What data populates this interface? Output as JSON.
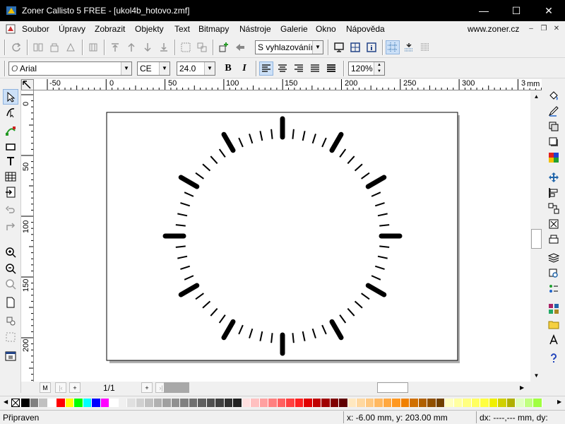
{
  "window": {
    "title": "Zoner Callisto 5 FREE - [ukol4b_hotovo.zmf]",
    "minimize_label": "—",
    "maximize_label": "☐",
    "close_label": "✕"
  },
  "menu": {
    "items": [
      "Soubor",
      "Úpravy",
      "Zobrazit",
      "Objekty",
      "Text",
      "Bitmapy",
      "Nástroje",
      "Galerie",
      "Okno",
      "Nápověda"
    ],
    "url": "www.zoner.cz",
    "mdi_minimize": "–",
    "mdi_restore": "❐",
    "mdi_close": "✕"
  },
  "toolbar1": {
    "smoothing_select": "S vyhlazováním"
  },
  "toolbar2": {
    "font_select": "Arial",
    "charset_select": "CE",
    "font_size": "24.0",
    "bold_label": "B",
    "italic_label": "I",
    "zoom_value": "120%"
  },
  "rulers": {
    "h_labels": [
      "-50",
      "0",
      "50",
      "100",
      "150",
      "200",
      "250",
      "300",
      "3"
    ],
    "h_unit": "mm",
    "v_labels": [
      "0",
      "50",
      "100",
      "150",
      "200"
    ]
  },
  "navigation": {
    "page_indicator": "1/1",
    "first_label": "M",
    "add_label": "+"
  },
  "palette": {
    "colors": [
      "#000000",
      "#808080",
      "#c0c0c0",
      "#ffffff",
      "#ff0000",
      "#ffff00",
      "#00ff00",
      "#00ffff",
      "#0000ff",
      "#ff00ff",
      "#ffffff",
      "#f0f0f0",
      "#e0e0e0",
      "#d0d0d0",
      "#c0c0c0",
      "#b0b0b0",
      "#a0a0a0",
      "#909090",
      "#808080",
      "#707070",
      "#606060",
      "#505050",
      "#404040",
      "#303030",
      "#202020",
      "#ffe0e0",
      "#ffc0c0",
      "#ffa0a0",
      "#ff8080",
      "#ff6060",
      "#ff4040",
      "#ff2020",
      "#e00000",
      "#c00000",
      "#a00000",
      "#800000",
      "#600000",
      "#ffe8c0",
      "#ffd8a0",
      "#ffc880",
      "#ffb860",
      "#ffa840",
      "#ff9820",
      "#f08000",
      "#d07000",
      "#b06000",
      "#905000",
      "#704000",
      "#ffffc0",
      "#ffffa0",
      "#ffff80",
      "#ffff60",
      "#ffff40",
      "#f0f000",
      "#d0d000",
      "#b0b000",
      "#e0ffc0",
      "#c0ff80",
      "#a0ff40"
    ]
  },
  "status": {
    "ready": "Připraven",
    "coords": "x: -6.00 mm, y: 203.00 mm",
    "delta": "dx: ----,--- mm, dy:"
  },
  "colors": {
    "titlebar_bg": "#000000",
    "active_tool_bg": "#cce0f7",
    "page_bg": "#ffffff"
  }
}
